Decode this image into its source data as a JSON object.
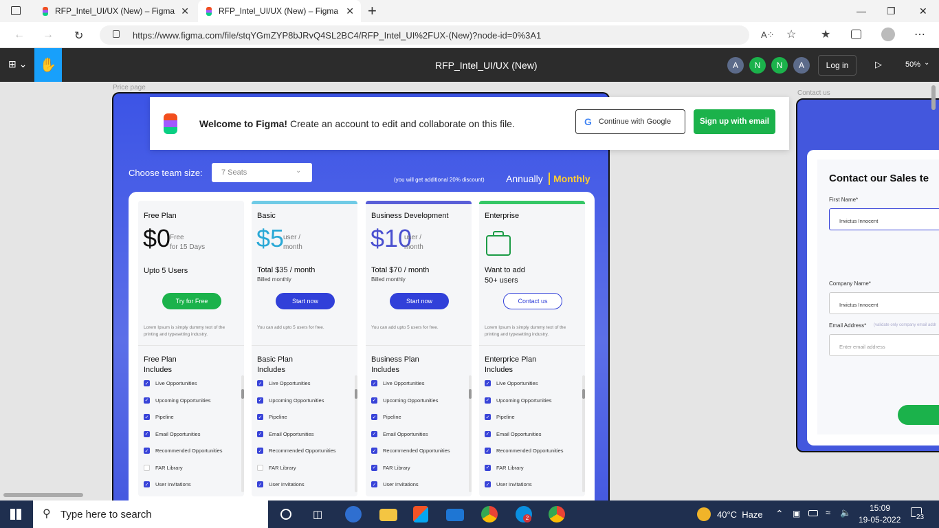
{
  "browser": {
    "tabs": [
      {
        "title": "RFP_Intel_UI/UX (New) – Figma"
      },
      {
        "title": "RFP_Intel_UI/UX (New) – Figma"
      }
    ],
    "url": "https://www.figma.com/file/stqYGmZYP8bJRvQ4SL2BC4/RFP_Intel_UI%2FUX-(New)?node-id=0%3A1",
    "new_tab": "+",
    "close": "✕"
  },
  "figma": {
    "file_title": "RFP_Intel_UI/UX (New)",
    "avatars": [
      {
        "letter": "A",
        "color": "#5c6b8a"
      },
      {
        "letter": "N",
        "color": "#1bb24b"
      },
      {
        "letter": "N",
        "color": "#1bb24b"
      },
      {
        "letter": "A",
        "color": "#5c6b8a"
      }
    ],
    "login": "Log in",
    "zoom": "50%"
  },
  "banner": {
    "welcome": "Welcome to Figma!",
    "message": "Create an account to edit and collaborate on this file.",
    "google_btn": "Continue with Google",
    "email_btn": "Sign up with email"
  },
  "price_page": {
    "label": "Price page",
    "team_label": "Choose team size:",
    "team_value": "7 Seats",
    "discount": "(you will get additional 20% discount)",
    "annually": "Annually",
    "monthly": "Monthly",
    "plans": [
      {
        "name": "Free Plan",
        "price": "$0",
        "unit1": "Free",
        "unit2": "for 15 Days",
        "total": "Upto 5 Users",
        "billed": "",
        "button": "Try for Free",
        "note": "Lorem Ipsum is simply dummy text of the printing and typesetting industry.",
        "includes1": "Free Plan",
        "includes2": "Includes",
        "bar": "#f5f6f8",
        "accent": "#111",
        "btn": "#1bb24b"
      },
      {
        "name": "Basic",
        "price": "$5",
        "unit1": "user /",
        "unit2": "month",
        "total": "Total $35 / month",
        "billed": "Billed monthly",
        "button": "Start now",
        "note": "You can add upto 5 users for free.",
        "includes1": "Basic Plan",
        "includes2": "Includes",
        "bar": "#6fcbe6",
        "accent": "#2ba9d6",
        "btn": "#3140d9"
      },
      {
        "name": "Business Development",
        "price": "$10",
        "unit1": "user /",
        "unit2": "month",
        "total": "Total $70 / month",
        "billed": "Billed monthly",
        "button": "Start now",
        "note": "You can add upto 5 users for free.",
        "includes1": "Business Plan",
        "includes2": "Includes",
        "bar": "#5a5fd8",
        "accent": "#4a50d0",
        "btn": "#3140d9"
      },
      {
        "name": "Enterprise",
        "price": "",
        "unit1": "",
        "unit2": "",
        "total": "Want to add",
        "total2": "50+ users",
        "billed": "",
        "button": "Contact us",
        "note": "Lorem Ipsum is simply dummy text of the printing and typesetting industry.",
        "includes1": "Enterprice Plan",
        "includes2": "Includes",
        "bar": "#35c766",
        "accent": "#1b9b45",
        "btn": "#fff"
      }
    ],
    "features": [
      "Live Opportunities",
      "Upcoming Opportunities",
      "Pipeline",
      "Email Opportunities",
      "Recommended Opportunities",
      "FAR Library",
      "User Invitations"
    ],
    "checks": [
      [
        1,
        1,
        1,
        1,
        1,
        0,
        1
      ],
      [
        1,
        1,
        1,
        1,
        1,
        0,
        1
      ],
      [
        1,
        1,
        1,
        1,
        1,
        1,
        1
      ],
      [
        1,
        1,
        1,
        1,
        1,
        1,
        1
      ]
    ]
  },
  "contact": {
    "label": "Contact us",
    "title": "Contact our Sales te",
    "first_label": "First Name*",
    "first_value": "Invictus Innocent",
    "company_label": "Company Name*",
    "company_value": "Invictus Innocent",
    "email_label": "Email Address*",
    "email_hint": "(validate only company email addr",
    "email_placeholder": "Enter email address"
  },
  "taskbar": {
    "search": "Type here to search",
    "weather": "40°C  Haze",
    "time": "15:09",
    "date": "19-05-2022",
    "notif": "23",
    "skype_badge": "2"
  }
}
